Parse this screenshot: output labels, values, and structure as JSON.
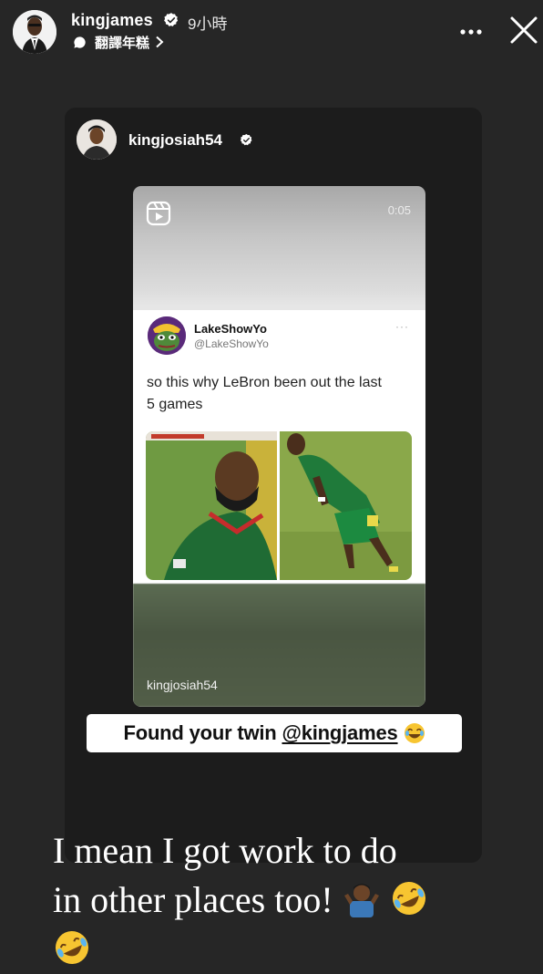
{
  "header": {
    "username": "kingjames",
    "time": "9小時",
    "translate_label": "翻譯年糕"
  },
  "card": {
    "username": "kingjosiah54",
    "reel": {
      "duration": "0:05",
      "author": "kingjosiah54",
      "tweet": {
        "name": "LakeShowYo",
        "handle": "@LakeShowYo",
        "more": "···",
        "text_line1": "so this why LeBron been out the last",
        "text_line2": "5 games"
      }
    },
    "sticker": {
      "text": "Found your twin ",
      "mention": "@kingjames"
    }
  },
  "caption": {
    "line1": "I mean I got work to do",
    "line2": "in other places too!"
  },
  "colors": {
    "background": "#262626",
    "card": "#1c1c1c",
    "jersey_green": "#1f7a3a"
  },
  "icons": [
    "verified-badge-icon",
    "translate-bubble-icon",
    "chevron-right-icon",
    "more-icon",
    "close-icon",
    "reels-icon",
    "laughing-emoji-icon",
    "shrug-emoji-icon",
    "rofl-emoji-icon"
  ]
}
